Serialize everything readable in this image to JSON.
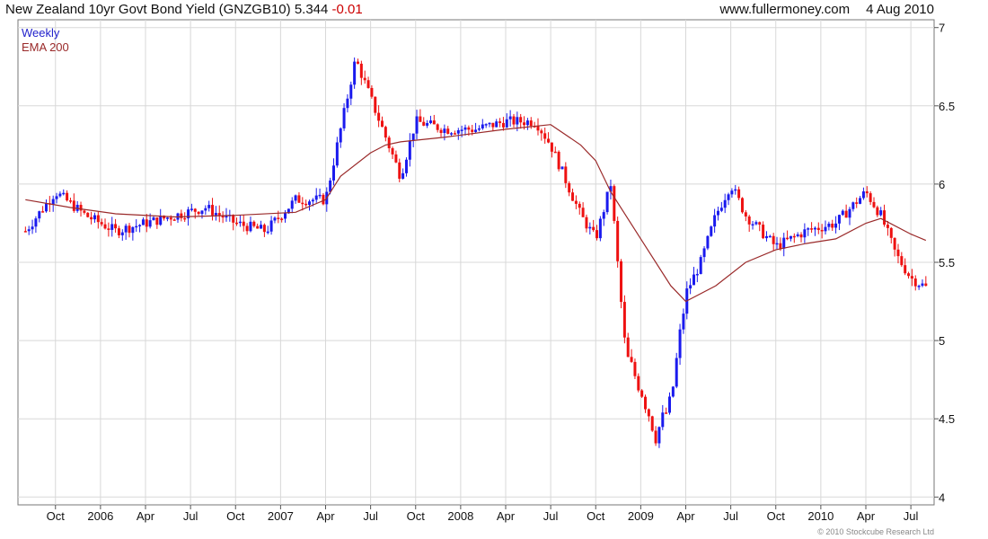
{
  "header": {
    "title_main": "New Zealand 10yr Govt Bond Yield (GNZGB10)",
    "last_value": "5.344",
    "change": "-0.01",
    "source": "www.fullermoney.com",
    "date": "4 Aug 2010"
  },
  "legend": {
    "series_1": "Weekly",
    "series_2": "EMA 200"
  },
  "footer": {
    "copyright": "© 2010 Stockcube Research Ltd"
  },
  "colors": {
    "up": "#1a1aee",
    "down": "#ee1111",
    "ema": "#9a2a2a",
    "grid": "#d8d8d8"
  },
  "chart_data": {
    "type": "line",
    "title": "New Zealand 10yr Govt Bond Yield (GNZGB10)",
    "xlabel": "",
    "ylabel": "",
    "ylim": [
      3.95,
      7.05
    ],
    "y_ticks": [
      "4",
      "4.5",
      "5",
      "5.5",
      "6",
      "6.5",
      "7"
    ],
    "x_tick_labels": [
      "Oct",
      "2006",
      "Apr",
      "Jul",
      "Oct",
      "2007",
      "Apr",
      "Jul",
      "Oct",
      "2008",
      "Apr",
      "Jul",
      "Oct",
      "2009",
      "Apr",
      "Jul",
      "Oct",
      "2010",
      "Apr",
      "Jul"
    ],
    "grid": true,
    "legend_position": "top-left",
    "y_axis_side": "right",
    "series": [
      {
        "name": "Weekly",
        "style": "weekly price bars (blue up / red down)",
        "x": [
          "Aug 2005",
          "Oct 2005",
          "Dec 2005",
          "Feb 2006",
          "Apr 2006",
          "Jun 2006",
          "Aug 2006",
          "Oct 2006",
          "Dec 2006",
          "Feb 2007",
          "Apr 2007",
          "Jun 2007",
          "Jul 2007",
          "Sep 2007",
          "Oct 2007",
          "Dec 2007",
          "Feb 2008",
          "Apr 2008",
          "Jun 2008",
          "Jul 2008",
          "Sep 2008",
          "Oct 2008",
          "Nov 2008",
          "Dec 2008",
          "Jan 2009",
          "Feb 2009",
          "Mar 2009",
          "Apr 2009",
          "May 2009",
          "Jun 2009",
          "Jul 2009",
          "Aug 2009",
          "Oct 2009",
          "Dec 2009",
          "Feb 2010",
          "Apr 2010",
          "May 2010",
          "Jun 2010",
          "Jul 2010",
          "Aug 2010"
        ],
        "values": [
          5.7,
          5.95,
          5.8,
          5.7,
          5.75,
          5.8,
          5.85,
          5.75,
          5.7,
          5.9,
          5.9,
          6.8,
          6.55,
          6.05,
          6.4,
          6.35,
          6.35,
          6.4,
          6.4,
          6.25,
          5.8,
          5.65,
          6.0,
          4.9,
          4.7,
          4.4,
          4.6,
          5.3,
          5.5,
          5.8,
          6.0,
          5.8,
          5.6,
          5.7,
          5.75,
          5.95,
          5.8,
          5.55,
          5.4,
          5.34
        ]
      },
      {
        "name": "EMA 200",
        "style": "line",
        "x": [
          "Aug 2005",
          "Nov 2005",
          "Feb 2006",
          "Jun 2006",
          "Oct 2006",
          "Feb 2007",
          "Apr 2007",
          "May 2007",
          "Jul 2007",
          "Aug 2007",
          "Sep 2007",
          "Dec 2007",
          "Apr 2008",
          "Jul 2008",
          "Sep 2008",
          "Oct 2008",
          "Nov 2008",
          "Jan 2009",
          "Mar 2009",
          "Apr 2009",
          "Jun 2009",
          "Aug 2009",
          "Oct 2009",
          "Dec 2009",
          "Feb 2010",
          "Apr 2010",
          "May 2010",
          "Jul 2010",
          "Aug 2010"
        ],
        "values": [
          5.9,
          5.85,
          5.81,
          5.79,
          5.8,
          5.82,
          5.9,
          6.05,
          6.2,
          6.25,
          6.27,
          6.3,
          6.35,
          6.38,
          6.25,
          6.15,
          5.95,
          5.65,
          5.35,
          5.25,
          5.35,
          5.5,
          5.58,
          5.62,
          5.65,
          5.75,
          5.78,
          5.68,
          5.64
        ]
      }
    ]
  }
}
